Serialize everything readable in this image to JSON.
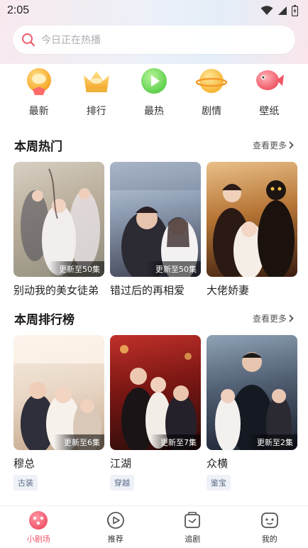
{
  "status": {
    "time": "2:05"
  },
  "search": {
    "placeholder": "今日正在热播"
  },
  "categories": [
    {
      "label": "最新",
      "icon": "newest-icon"
    },
    {
      "label": "排行",
      "icon": "crown-icon"
    },
    {
      "label": "最热",
      "icon": "play-icon"
    },
    {
      "label": "剧情",
      "icon": "planet-icon"
    },
    {
      "label": "壁纸",
      "icon": "fish-icon"
    }
  ],
  "weekly_hot": {
    "title": "本周热门",
    "more": "查看更多",
    "items": [
      {
        "title": "别动我的美女徒弟",
        "badge": "更新至50集"
      },
      {
        "title": "错过后的再相爱",
        "badge": "更新至50集"
      },
      {
        "title": "大佬娇妻",
        "badge": ""
      }
    ]
  },
  "weekly_rank": {
    "title": "本周排行榜",
    "more": "查看更多",
    "items": [
      {
        "title": "穆总",
        "badge": "更新至6集",
        "tag": "古装"
      },
      {
        "title": "江湖",
        "badge": "更新至7集",
        "tag": "穿越"
      },
      {
        "title": "众横",
        "badge": "更新至2集",
        "tag": "鉴宝"
      }
    ]
  },
  "tabs": [
    {
      "label": "小剧场",
      "icon": "theater-icon",
      "active": true
    },
    {
      "label": "推荐",
      "icon": "recommend-icon",
      "active": false
    },
    {
      "label": "追剧",
      "icon": "follow-icon",
      "active": false
    },
    {
      "label": "我的",
      "icon": "profile-icon",
      "active": false
    }
  ],
  "colors": {
    "accent": "#f0556b",
    "tag_bg": "#eef1f7",
    "tag_text": "#5c6b88"
  }
}
